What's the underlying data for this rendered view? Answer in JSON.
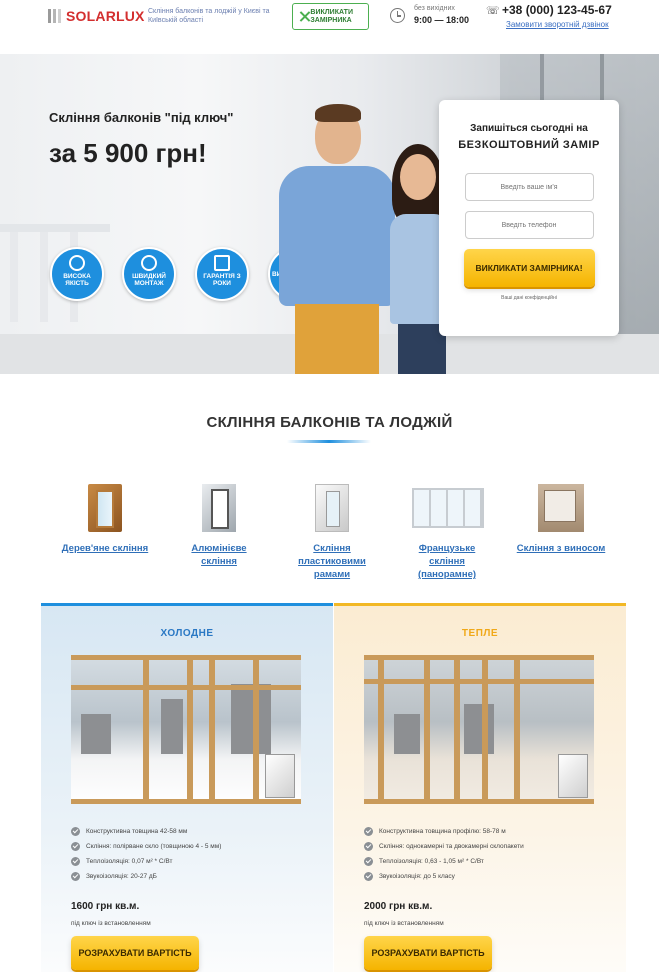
{
  "header": {
    "logo": "SOLARLUX",
    "tagline": "Скління балконів та лоджій у Києві та Київській області",
    "call_button": "ВИКЛИКАТИ ЗАМІРНИКА",
    "hours_note": "без вихідних",
    "hours": "9:00 — 18:00",
    "phone": "+38 (000) 123-45-67",
    "callback_link": "Замовити зворотній дзвінок"
  },
  "hero": {
    "title": "Скління балконів \"під ключ\"",
    "price": "за 5 900 грн!",
    "badges": [
      {
        "label": "ВИСОКА ЯКІСТЬ",
        "icon": "medal-icon"
      },
      {
        "label": "ШВИДКИЙ МОНТАЖ",
        "icon": "stopwatch-icon"
      },
      {
        "label": "ГАРАНТІЯ З РОКИ",
        "icon": "calendar-icon"
      },
      {
        "label": "ВИВІЗ СМІТТЯ",
        "icon": "truck-icon"
      }
    ]
  },
  "form": {
    "heading1": "Запишіться сьогодні на",
    "heading2": "БЕЗКОШТОВНИЙ ЗАМІР",
    "name_placeholder": "Введіть ваше ім'я",
    "phone_placeholder": "Введіть телефон",
    "submit": "ВИКЛИКАТИ ЗАМІРНИКА!",
    "privacy": "Ваші дані конфіденційні"
  },
  "types_section": {
    "title": "СКЛІННЯ БАЛКОНІВ ТА ЛОДЖІЙ",
    "items": [
      {
        "label": "Дерев'яне скління"
      },
      {
        "label": "Алюмінієве скління"
      },
      {
        "label": "Скління пластиковими рамами"
      },
      {
        "label": "Французьке скління (панорамне)"
      },
      {
        "label": "Скління з виносом"
      }
    ]
  },
  "cards": [
    {
      "title": "ХОЛОДНЕ",
      "features": [
        "Конструктивна товщина 42-58 мм",
        "Скління: полірване скло (товщиною 4 - 5 мм)",
        "Теплоізоляція: 0,07 м² * С/Вт",
        "Звукоізоляція: 20-27 дБ"
      ],
      "price": "1600 грн кв.м.",
      "price_note": "під ключ із встановленням",
      "button": "РОЗРАХУВАТИ ВАРТІСТЬ"
    },
    {
      "title": "ТЕПЛЕ",
      "features": [
        "Конструктивна товщина профілю: 58-78 м",
        "Скління: однокамерні та двокамерні склопакети",
        "Теплоізоляція: 0,63 - 1,05 м² * С/Вт",
        "Звукоізоляція: до 5 класу"
      ],
      "price": "2000 грн кв.м.",
      "price_note": "під ключ із встановленням",
      "button": "РОЗРАХУВАТИ ВАРТІСТЬ"
    }
  ],
  "colors": {
    "brand_red": "#d32f2f",
    "accent_blue": "#1e8fde",
    "button_yellow": "#f5b400",
    "accent_green": "#4caf50"
  }
}
